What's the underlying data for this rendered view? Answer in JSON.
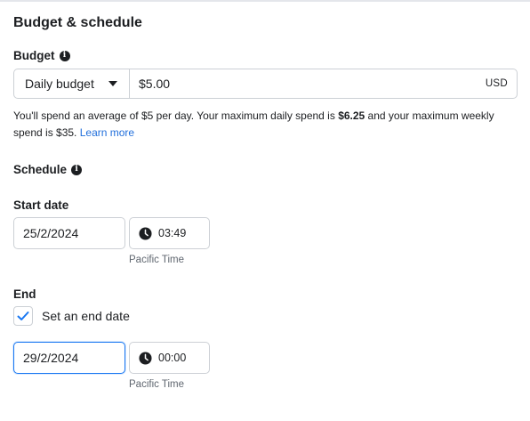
{
  "section": {
    "title": "Budget & schedule"
  },
  "budget": {
    "label": "Budget",
    "type_value": "Daily budget",
    "amount_value": "$5.00",
    "currency": "USD",
    "help": {
      "part1": "You'll spend an average of $5 per day. Your maximum daily spend is ",
      "max_daily": "$6.25",
      "part2": " and your maximum weekly spend is $35.",
      "link": "Learn more"
    }
  },
  "schedule": {
    "label": "Schedule",
    "start": {
      "label": "Start date",
      "date_value": "25/2/2024",
      "time_value": "03:49",
      "timezone": "Pacific Time"
    },
    "end": {
      "label": "End",
      "checkbox_label": "Set an end date",
      "checkbox_checked": true,
      "date_value": "29/2/2024",
      "time_value": "00:00",
      "timezone": "Pacific Time"
    }
  },
  "icons": {
    "info": "info-icon",
    "caret": "caret-down-icon",
    "clock": "clock-icon",
    "check": "checkmark-icon"
  },
  "colors": {
    "link": "#216fdb",
    "focus_border": "#1877f2",
    "checkmark": "#1877f2",
    "border": "#ccd0d5"
  }
}
